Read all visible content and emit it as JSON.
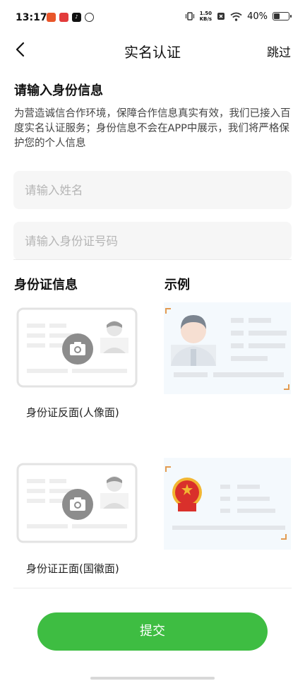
{
  "status_bar": {
    "time": "13:17",
    "net_speed_value": "1.50",
    "net_speed_unit": "KB/s",
    "battery_text": "40%",
    "battery_level": 0.4
  },
  "nav": {
    "title": "实名认证",
    "skip_label": "跳过"
  },
  "form": {
    "section_title": "请输入身份信息",
    "intro": "为营造诚信合作环境，保障合作信息真实有效，我们已接入百度实名认证服务；身份信息不会在APP中展示，我们将严格保护您的个人信息",
    "name_placeholder": "请输入姓名",
    "id_placeholder": "请输入身份证号码"
  },
  "id_section": {
    "left_header": "身份证信息",
    "right_header": "示例",
    "back_label": "身份证反面(人像面)",
    "front_label": "身份证正面(国徽面)"
  },
  "submit_label": "提交",
  "colors": {
    "accent": "#3ebd42",
    "corner": "#e39b52",
    "emblem_red": "#d9302b",
    "emblem_gold": "#f2b632"
  }
}
